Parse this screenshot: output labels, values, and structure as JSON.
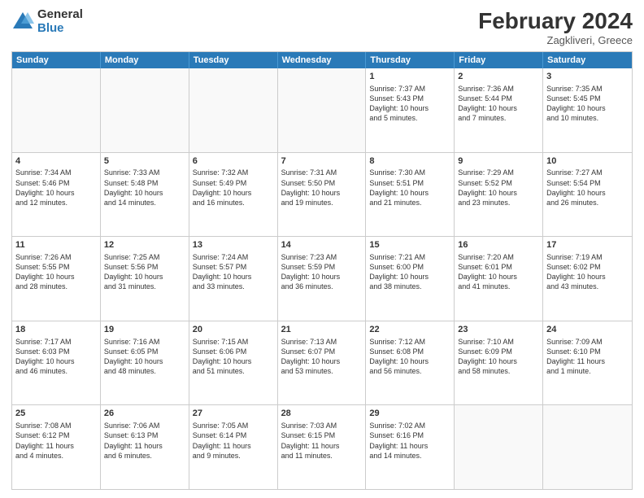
{
  "logo": {
    "general": "General",
    "blue": "Blue"
  },
  "title": {
    "month": "February 2024",
    "location": "Zagkliveri, Greece"
  },
  "days": [
    "Sunday",
    "Monday",
    "Tuesday",
    "Wednesday",
    "Thursday",
    "Friday",
    "Saturday"
  ],
  "rows": [
    [
      {
        "day": "",
        "detail": ""
      },
      {
        "day": "",
        "detail": ""
      },
      {
        "day": "",
        "detail": ""
      },
      {
        "day": "",
        "detail": ""
      },
      {
        "day": "1",
        "detail": "Sunrise: 7:37 AM\nSunset: 5:43 PM\nDaylight: 10 hours\nand 5 minutes."
      },
      {
        "day": "2",
        "detail": "Sunrise: 7:36 AM\nSunset: 5:44 PM\nDaylight: 10 hours\nand 7 minutes."
      },
      {
        "day": "3",
        "detail": "Sunrise: 7:35 AM\nSunset: 5:45 PM\nDaylight: 10 hours\nand 10 minutes."
      }
    ],
    [
      {
        "day": "4",
        "detail": "Sunrise: 7:34 AM\nSunset: 5:46 PM\nDaylight: 10 hours\nand 12 minutes."
      },
      {
        "day": "5",
        "detail": "Sunrise: 7:33 AM\nSunset: 5:48 PM\nDaylight: 10 hours\nand 14 minutes."
      },
      {
        "day": "6",
        "detail": "Sunrise: 7:32 AM\nSunset: 5:49 PM\nDaylight: 10 hours\nand 16 minutes."
      },
      {
        "day": "7",
        "detail": "Sunrise: 7:31 AM\nSunset: 5:50 PM\nDaylight: 10 hours\nand 19 minutes."
      },
      {
        "day": "8",
        "detail": "Sunrise: 7:30 AM\nSunset: 5:51 PM\nDaylight: 10 hours\nand 21 minutes."
      },
      {
        "day": "9",
        "detail": "Sunrise: 7:29 AM\nSunset: 5:52 PM\nDaylight: 10 hours\nand 23 minutes."
      },
      {
        "day": "10",
        "detail": "Sunrise: 7:27 AM\nSunset: 5:54 PM\nDaylight: 10 hours\nand 26 minutes."
      }
    ],
    [
      {
        "day": "11",
        "detail": "Sunrise: 7:26 AM\nSunset: 5:55 PM\nDaylight: 10 hours\nand 28 minutes."
      },
      {
        "day": "12",
        "detail": "Sunrise: 7:25 AM\nSunset: 5:56 PM\nDaylight: 10 hours\nand 31 minutes."
      },
      {
        "day": "13",
        "detail": "Sunrise: 7:24 AM\nSunset: 5:57 PM\nDaylight: 10 hours\nand 33 minutes."
      },
      {
        "day": "14",
        "detail": "Sunrise: 7:23 AM\nSunset: 5:59 PM\nDaylight: 10 hours\nand 36 minutes."
      },
      {
        "day": "15",
        "detail": "Sunrise: 7:21 AM\nSunset: 6:00 PM\nDaylight: 10 hours\nand 38 minutes."
      },
      {
        "day": "16",
        "detail": "Sunrise: 7:20 AM\nSunset: 6:01 PM\nDaylight: 10 hours\nand 41 minutes."
      },
      {
        "day": "17",
        "detail": "Sunrise: 7:19 AM\nSunset: 6:02 PM\nDaylight: 10 hours\nand 43 minutes."
      }
    ],
    [
      {
        "day": "18",
        "detail": "Sunrise: 7:17 AM\nSunset: 6:03 PM\nDaylight: 10 hours\nand 46 minutes."
      },
      {
        "day": "19",
        "detail": "Sunrise: 7:16 AM\nSunset: 6:05 PM\nDaylight: 10 hours\nand 48 minutes."
      },
      {
        "day": "20",
        "detail": "Sunrise: 7:15 AM\nSunset: 6:06 PM\nDaylight: 10 hours\nand 51 minutes."
      },
      {
        "day": "21",
        "detail": "Sunrise: 7:13 AM\nSunset: 6:07 PM\nDaylight: 10 hours\nand 53 minutes."
      },
      {
        "day": "22",
        "detail": "Sunrise: 7:12 AM\nSunset: 6:08 PM\nDaylight: 10 hours\nand 56 minutes."
      },
      {
        "day": "23",
        "detail": "Sunrise: 7:10 AM\nSunset: 6:09 PM\nDaylight: 10 hours\nand 58 minutes."
      },
      {
        "day": "24",
        "detail": "Sunrise: 7:09 AM\nSunset: 6:10 PM\nDaylight: 11 hours\nand 1 minute."
      }
    ],
    [
      {
        "day": "25",
        "detail": "Sunrise: 7:08 AM\nSunset: 6:12 PM\nDaylight: 11 hours\nand 4 minutes."
      },
      {
        "day": "26",
        "detail": "Sunrise: 7:06 AM\nSunset: 6:13 PM\nDaylight: 11 hours\nand 6 minutes."
      },
      {
        "day": "27",
        "detail": "Sunrise: 7:05 AM\nSunset: 6:14 PM\nDaylight: 11 hours\nand 9 minutes."
      },
      {
        "day": "28",
        "detail": "Sunrise: 7:03 AM\nSunset: 6:15 PM\nDaylight: 11 hours\nand 11 minutes."
      },
      {
        "day": "29",
        "detail": "Sunrise: 7:02 AM\nSunset: 6:16 PM\nDaylight: 11 hours\nand 14 minutes."
      },
      {
        "day": "",
        "detail": ""
      },
      {
        "day": "",
        "detail": ""
      }
    ]
  ]
}
